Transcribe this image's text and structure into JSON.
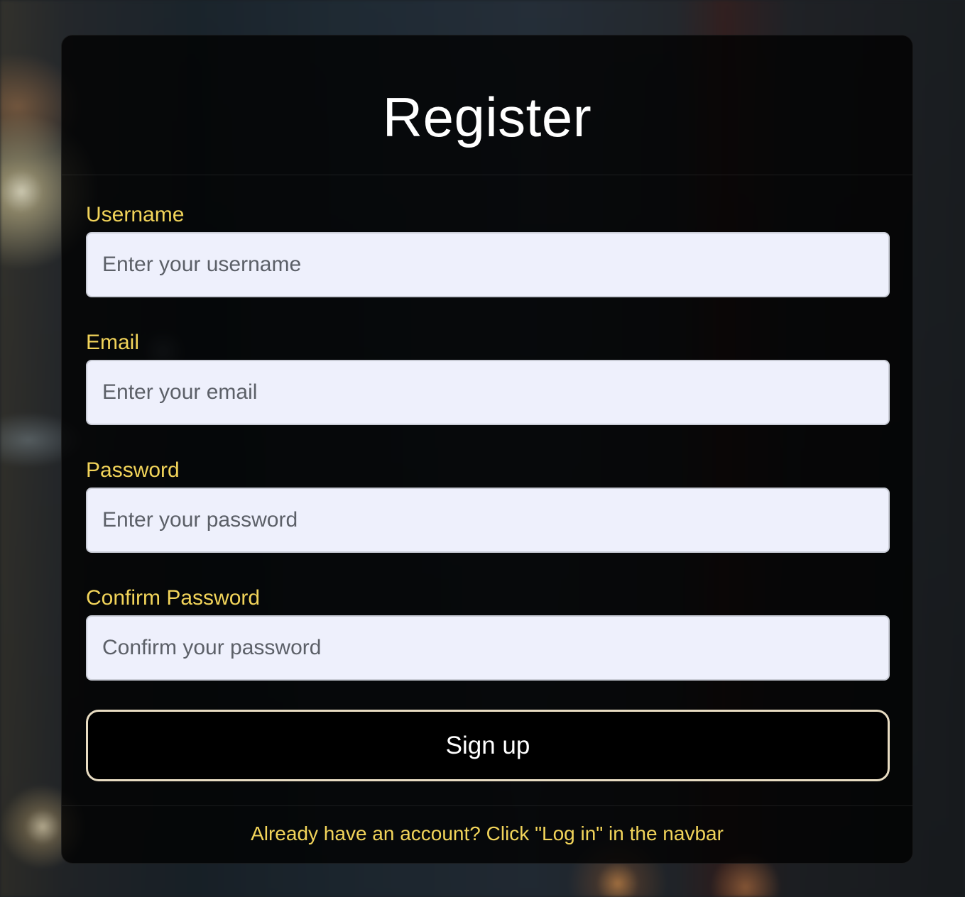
{
  "form": {
    "title": "Register",
    "fields": [
      {
        "label": "Username",
        "placeholder": "Enter your username",
        "type": "text"
      },
      {
        "label": "Email",
        "placeholder": "Enter your email",
        "type": "email"
      },
      {
        "label": "Password",
        "placeholder": "Enter your password",
        "type": "password"
      },
      {
        "label": "Confirm Password",
        "placeholder": "Confirm your password",
        "type": "password"
      }
    ],
    "submit_label": "Sign up",
    "footer_text": "Already have an account? Click \"Log in\" in the navbar"
  },
  "colors": {
    "label": "#f2d45a",
    "input_background": "#eef0fc",
    "button_background": "#000000",
    "button_border": "#e8dcc2",
    "title": "#ffffff"
  }
}
